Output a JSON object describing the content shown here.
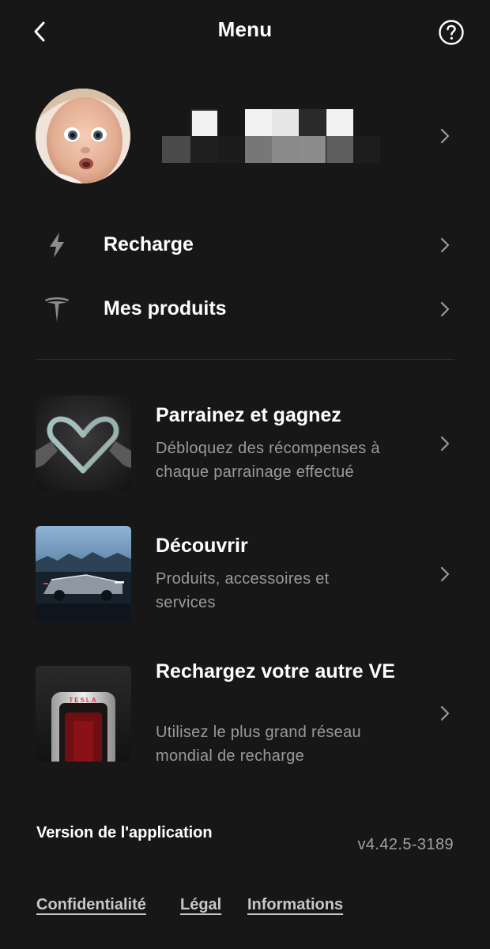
{
  "header": {
    "title": "Menu",
    "back_icon": "back-chevron-icon",
    "help_icon": "help-circle-icon"
  },
  "profile": {
    "name": "",
    "name_obscured": true,
    "avatar": "user-photo"
  },
  "menu": [
    {
      "id": "recharge",
      "label": "Recharge",
      "icon": "lightning-bolt-icon"
    },
    {
      "id": "products",
      "label": "Mes produits",
      "icon": "tesla-logo-icon"
    }
  ],
  "promos": [
    {
      "id": "referral",
      "title": "Parrainez et gagnez",
      "description": "Débloquez des récompenses à chaque parrainage effectué",
      "image": "robot-hands-heart"
    },
    {
      "id": "discover",
      "title": "Découvrir",
      "description": "Produits, accessoires et services",
      "image": "cybertruck-landscape"
    },
    {
      "id": "charge-other-ev",
      "title": "Rechargez votre autre VE",
      "description": "Utilisez le plus grand réseau mondial de recharge",
      "image": "tesla-supercharger",
      "image_text": "TESLA"
    }
  ],
  "footer": {
    "version_label": "Version de l'application",
    "version_value": "v4.42.5-3189",
    "links": [
      "Confidentialité",
      "Légal",
      "Informations"
    ]
  },
  "colors": {
    "background": "#171717",
    "text_primary": "#ffffff",
    "text_secondary": "#9a9a9a",
    "divider": "#2b2b2b"
  }
}
